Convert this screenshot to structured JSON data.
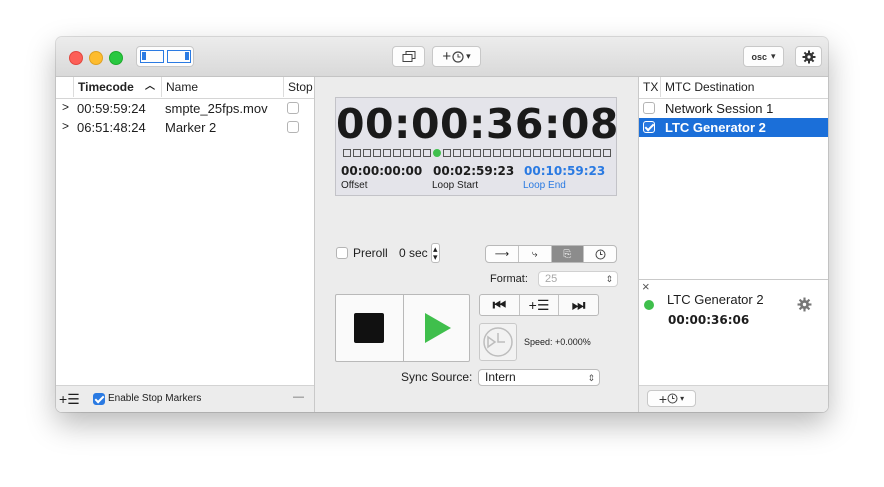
{
  "toolbar": {
    "osc_label": "osc",
    "add_timer_label": "+",
    "dropdown_caret": "⌄"
  },
  "left_table": {
    "headers": {
      "timecode": "Timecode",
      "sort_arrow": "^",
      "name": "Name",
      "stop": "Stop"
    },
    "rows": [
      {
        "timecode": "00:59:59:24",
        "name": "smpte_25fps.mov",
        "stop": false
      },
      {
        "timecode": "06:51:48:24",
        "name": "Marker 2",
        "stop": false
      }
    ],
    "footer": {
      "enable_stop_markers": "Enable Stop Markers",
      "enable_checked": true,
      "minus": "—"
    }
  },
  "timecode": {
    "main": "00:00:36:08",
    "offset_value": "00:00:00:00",
    "offset_label": "Offset",
    "loop_start_value": "00:02:59:23",
    "loop_start_label": "Loop Start",
    "loop_end_value": "00:10:59:23",
    "loop_end_label": "Loop End",
    "accent_color": "#2a7ae2",
    "indicator_color": "#3fbf4c"
  },
  "preroll": {
    "label": "Preroll",
    "checked": false,
    "value": "0 sec"
  },
  "format": {
    "label": "Format:",
    "value": "25"
  },
  "speed": {
    "text": "Speed: +0.000%"
  },
  "sync": {
    "label": "Sync Source:",
    "value": "Intern"
  },
  "right_table": {
    "headers": {
      "tx": "TX",
      "dest": "MTC Destination"
    },
    "rows": [
      {
        "name": "Network Session 1",
        "checked": false,
        "selected": false
      },
      {
        "name": "LTC Generator 2",
        "checked": true,
        "selected": true
      }
    ]
  },
  "detail": {
    "close": "×",
    "name": "LTC Generator 2",
    "timecode": "00:00:36:06",
    "status_color": "#3fbf4c"
  },
  "colors": {
    "selection": "#1b6fd9",
    "window_bg": "#ececec"
  }
}
